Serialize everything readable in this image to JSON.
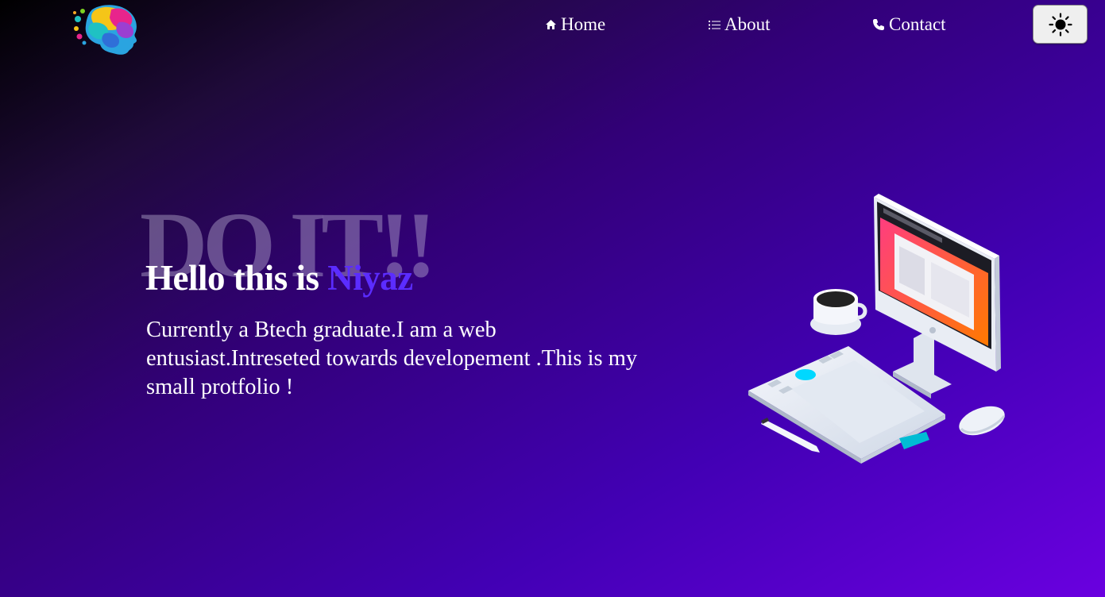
{
  "nav": {
    "home_label": "Home",
    "about_label": "About",
    "contact_label": "Contact",
    "home_icon": "home-icon",
    "about_icon": "list-icon",
    "contact_icon": "phone-icon"
  },
  "theme_toggle": {
    "icon": "sun-icon"
  },
  "hero": {
    "background_text": "DO IT!!",
    "greeting": "Hello this is ",
    "name": "Niyaz",
    "description": "Currently a Btech graduate.I am a web entusiast.Intreseted towards developement .This is my small protfolio !"
  },
  "colors": {
    "accent_name": "#5b2cff",
    "gradient_start": "#000000",
    "gradient_end": "#6a00e0"
  }
}
